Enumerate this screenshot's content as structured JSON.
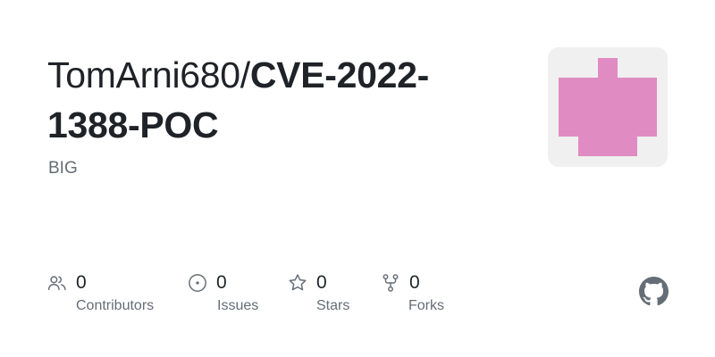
{
  "repo": {
    "owner": "TomArni680/",
    "name": "CVE-2022-1388-POC",
    "description": "BIG"
  },
  "avatar": {
    "color": "#e08cc2",
    "background": "#f0f0f0"
  },
  "stats": {
    "contributors": {
      "count": "0",
      "label": "Contributors",
      "icon": "people-icon"
    },
    "issues": {
      "count": "0",
      "label": "Issues",
      "icon": "issue-opened-icon"
    },
    "stars": {
      "count": "0",
      "label": "Stars",
      "icon": "star-icon"
    },
    "forks": {
      "count": "0",
      "label": "Forks",
      "icon": "repo-forked-icon"
    }
  },
  "brand": {
    "logo": "github-mark-icon",
    "icon_color": "#656d76"
  }
}
